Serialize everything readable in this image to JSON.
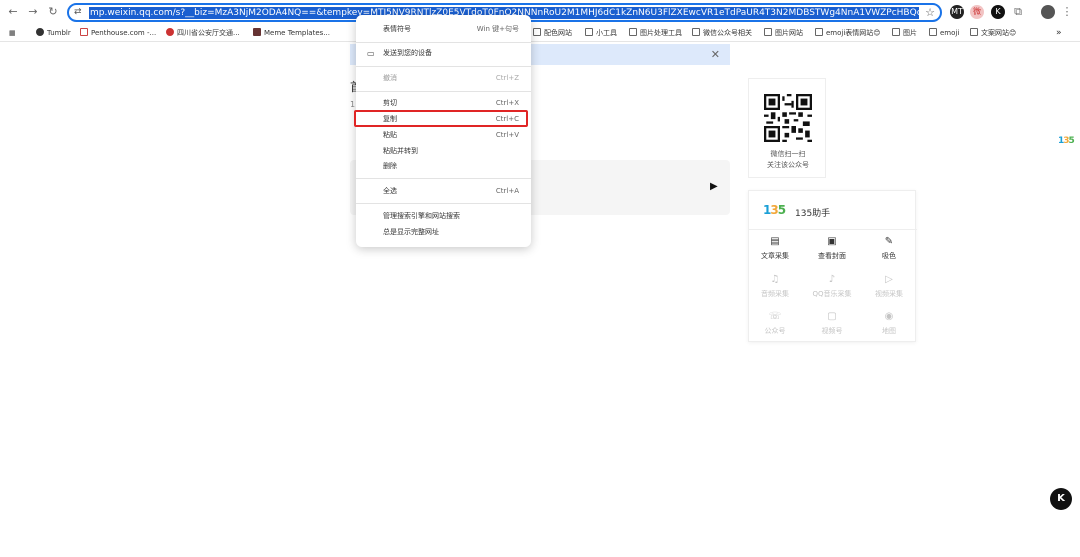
{
  "browser": {
    "url": "mp.weixin.qq.com/s?__biz=MzA3NjM2ODA4NQ==&tempkey=MTI5NV9RNTlzZ0E5VTdoT0FnQ2NNNnRoU2M1MHJ6dC1kZnN6U3FlZXEwcVR1eTdPaUR4T3N2MDBSTWg4NnA1VWZPcHBQcGwtaThQeGFyakRWVHBOWEllTG",
    "extensions": [
      "MT",
      "微",
      "K"
    ],
    "bookmarks": [
      {
        "label": "Tumblr",
        "icon": "tumblr-icon"
      },
      {
        "label": "Penthouse.com -...",
        "icon": "site-icon"
      },
      {
        "label": "四川省公安厅交通...",
        "icon": "emblem-icon"
      },
      {
        "label": "Meme Templates...",
        "icon": "meme-icon"
      },
      {
        "label": "配色网站",
        "icon": "folder-icon"
      },
      {
        "label": "小工具",
        "icon": "folder-icon"
      },
      {
        "label": "图片处理工具",
        "icon": "folder-icon"
      },
      {
        "label": "微信公众号相关",
        "icon": "folder-icon"
      },
      {
        "label": "图片网站",
        "icon": "folder-icon"
      },
      {
        "label": "emoji表情网站😊",
        "icon": "folder-icon"
      },
      {
        "label": "图片",
        "icon": "folder-icon"
      },
      {
        "label": "emoji",
        "icon": "folder-icon"
      },
      {
        "label": "文案网站😊",
        "icon": "folder-icon"
      }
    ],
    "overflow": "»"
  },
  "article": {
    "title_partial": "首",
    "meta_partial": "1"
  },
  "context_menu": {
    "emoji": {
      "label": "表情符号",
      "shortcut": "Win 键+句号"
    },
    "send_to_device": {
      "label": "发送到您的设备"
    },
    "undo": {
      "label": "撤消",
      "shortcut": "Ctrl+Z"
    },
    "cut": {
      "label": "剪切",
      "shortcut": "Ctrl+X"
    },
    "copy": {
      "label": "复制",
      "shortcut": "Ctrl+C"
    },
    "paste": {
      "label": "粘贴",
      "shortcut": "Ctrl+V"
    },
    "paste_and_go": {
      "label": "粘贴并转到"
    },
    "delete": {
      "label": "删除"
    },
    "select_all": {
      "label": "全选",
      "shortcut": "Ctrl+A"
    },
    "manage_search": {
      "label": "管理搜索引擎和网站搜索"
    },
    "show_full_url": {
      "label": "总是显示完整网址"
    }
  },
  "qr": {
    "line1": "微信扫一扫",
    "line2": "关注该公众号"
  },
  "helper": {
    "logo": "135",
    "title": "135助手",
    "tools": [
      {
        "label": "文章采集",
        "icon": "document-icon",
        "enabled": true
      },
      {
        "label": "查看封面",
        "icon": "image-icon",
        "enabled": true
      },
      {
        "label": "吸色",
        "icon": "eyedropper-icon",
        "enabled": true
      },
      {
        "label": "音频采集",
        "icon": "audio-icon",
        "enabled": false
      },
      {
        "label": "QQ音乐采集",
        "icon": "music-icon",
        "enabled": false
      },
      {
        "label": "视频采集",
        "icon": "video-icon",
        "enabled": false
      },
      {
        "label": "公众号",
        "icon": "account-icon",
        "enabled": false
      },
      {
        "label": "视频号",
        "icon": "channels-icon",
        "enabled": false
      },
      {
        "label": "地图",
        "icon": "map-icon",
        "enabled": false
      }
    ]
  },
  "side_logo": "135",
  "fab": "K"
}
